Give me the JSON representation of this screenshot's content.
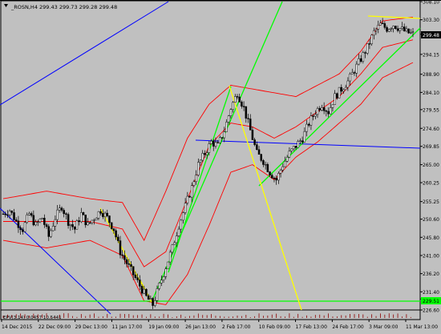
{
  "window": {
    "symbol_line": "_ROSN,H4  299.43  299.73  299.28  299.48"
  },
  "indicator": {
    "label": "EPV(3,14) 0.0457  10.5441"
  },
  "colors": {
    "background": "#c0c0c0",
    "candle": "#000000",
    "bollinger": "#ff0000",
    "trend_green": "#00ff00",
    "trend_yellow": "#ffff00",
    "trend_blue": "#0000ff",
    "price_marker": "#000000"
  },
  "chart_data": {
    "type": "candlestick",
    "title": "_ROSN,H4",
    "ylim": [
      226.6,
      308.1
    ],
    "y_ticks": [
      "308.10",
      "303.30",
      "299.48",
      "294.15",
      "288.90",
      "284.10",
      "279.55",
      "274.60",
      "269.85",
      "265.00",
      "260.25",
      "255.25",
      "250.60",
      "245.80",
      "241.00",
      "236.20",
      "231.40",
      "229.51",
      "226.60"
    ],
    "x_ticks": [
      "14 Dec 2015",
      "22 Dec 09:00",
      "29 Dec 13:00",
      "11 Jan 17:00",
      "19 Jan 09:00",
      "26 Jan 13:00",
      "2 Feb 17:00",
      "10 Feb 09:00",
      "17 Feb 13:00",
      "24 Feb 17:00",
      "3 Mar 09:00",
      "11 Mar 13:00"
    ],
    "last_price": "299.48",
    "support_price": "229.51",
    "price_path": [
      [
        0,
        252
      ],
      [
        3,
        253
      ],
      [
        6,
        250
      ],
      [
        9,
        248
      ],
      [
        12,
        252
      ],
      [
        15,
        249
      ],
      [
        18,
        251
      ],
      [
        21,
        246
      ],
      [
        24,
        251
      ],
      [
        27,
        254
      ],
      [
        30,
        250
      ],
      [
        33,
        248
      ],
      [
        36,
        252
      ],
      [
        39,
        249
      ],
      [
        42,
        251
      ],
      [
        45,
        253
      ],
      [
        48,
        251
      ],
      [
        51,
        248
      ],
      [
        54,
        242
      ],
      [
        57,
        239
      ],
      [
        60,
        236
      ],
      [
        63,
        233
      ],
      [
        66,
        230
      ],
      [
        69,
        228
      ],
      [
        72,
        233
      ],
      [
        75,
        238
      ],
      [
        78,
        243
      ],
      [
        81,
        249
      ],
      [
        84,
        254
      ],
      [
        87,
        259
      ],
      [
        90,
        265
      ],
      [
        93,
        268
      ],
      [
        96,
        271
      ],
      [
        99,
        270
      ],
      [
        102,
        274
      ],
      [
        105,
        280
      ],
      [
        108,
        284
      ],
      [
        111,
        280
      ],
      [
        114,
        274
      ],
      [
        117,
        268
      ],
      [
        120,
        266
      ],
      [
        123,
        263
      ],
      [
        126,
        261
      ],
      [
        129,
        265
      ],
      [
        132,
        268
      ],
      [
        135,
        270
      ],
      [
        138,
        272
      ],
      [
        141,
        276
      ],
      [
        144,
        279
      ],
      [
        147,
        281
      ],
      [
        150,
        279
      ],
      [
        153,
        283
      ],
      [
        156,
        285
      ],
      [
        159,
        287
      ],
      [
        162,
        290
      ],
      [
        165,
        293
      ],
      [
        168,
        296
      ],
      [
        171,
        300
      ],
      [
        174,
        302
      ],
      [
        177,
        301
      ],
      [
        180,
        302
      ],
      [
        183,
        301
      ],
      [
        186,
        300
      ],
      [
        189,
        299.48
      ]
    ],
    "bollinger_upper": [
      [
        0,
        256
      ],
      [
        20,
        258
      ],
      [
        40,
        256
      ],
      [
        55,
        255
      ],
      [
        65,
        245
      ],
      [
        75,
        258
      ],
      [
        85,
        272
      ],
      [
        95,
        281
      ],
      [
        105,
        286
      ],
      [
        115,
        285
      ],
      [
        125,
        284
      ],
      [
        135,
        283
      ],
      [
        145,
        286
      ],
      [
        155,
        289
      ],
      [
        165,
        295
      ],
      [
        175,
        303
      ],
      [
        189,
        304
      ]
    ],
    "bollinger_mid": [
      [
        0,
        250
      ],
      [
        20,
        250
      ],
      [
        40,
        250
      ],
      [
        55,
        248
      ],
      [
        65,
        238
      ],
      [
        75,
        242
      ],
      [
        85,
        256
      ],
      [
        95,
        270
      ],
      [
        105,
        276
      ],
      [
        115,
        275
      ],
      [
        125,
        272
      ],
      [
        135,
        275
      ],
      [
        145,
        279
      ],
      [
        155,
        283
      ],
      [
        165,
        289
      ],
      [
        175,
        296
      ],
      [
        189,
        298
      ]
    ],
    "bollinger_lower": [
      [
        0,
        245
      ],
      [
        20,
        243
      ],
      [
        40,
        245
      ],
      [
        55,
        241
      ],
      [
        65,
        229
      ],
      [
        75,
        228
      ],
      [
        85,
        236
      ],
      [
        95,
        249
      ],
      [
        105,
        263
      ],
      [
        115,
        265
      ],
      [
        125,
        261
      ],
      [
        135,
        267
      ],
      [
        145,
        271
      ],
      [
        155,
        276
      ],
      [
        165,
        281
      ],
      [
        175,
        288
      ],
      [
        189,
        292
      ]
    ]
  }
}
